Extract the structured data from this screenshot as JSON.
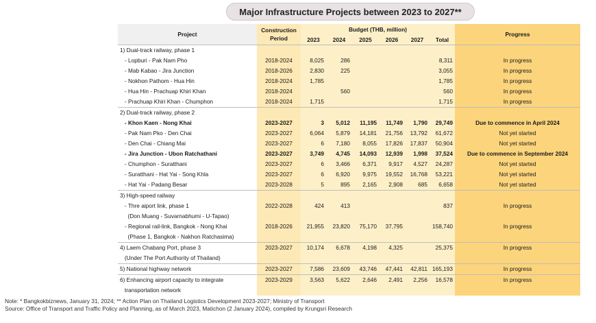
{
  "title": "Major Infrastructure Projects between 2023 to 2027**",
  "headers": {
    "project": "Project",
    "period": "Construction Period",
    "budget": "Budget (THB, million)",
    "years": [
      "2023",
      "2024",
      "2025",
      "2026",
      "2027",
      "Total"
    ],
    "progress": "Progress"
  },
  "rows": [
    {
      "project": "1) Dual-track railway, phase 1",
      "period": "",
      "v": [
        "",
        "",
        "",
        "",
        "",
        ""
      ],
      "progress": "",
      "sep": true
    },
    {
      "project": "   - Lopburi - Pak Nam Pho",
      "period": "2018-2024",
      "v": [
        "8,025",
        "286",
        "",
        "",
        "",
        "8,311"
      ],
      "progress": "In progress"
    },
    {
      "project": "   - Mab Kabao - Jira Junction",
      "period": "2018-2026",
      "v": [
        "2,830",
        "225",
        "",
        "",
        "",
        "3,055"
      ],
      "progress": "In progress"
    },
    {
      "project": "   - Nokhon Pathom - Hua Hin",
      "period": "2018-2024",
      "v": [
        "1,785",
        "",
        "",
        "",
        "",
        "1,785"
      ],
      "progress": "In progress"
    },
    {
      "project": "   - Hua Hin - Prachuap Khiri Khan",
      "period": "2018-2024",
      "v": [
        "",
        "560",
        "",
        "",
        "",
        "560"
      ],
      "progress": "In progress"
    },
    {
      "project": "   - Prachuap Khiri Khan - Chumphon",
      "period": "2018-2024",
      "v": [
        "1,715",
        "",
        "",
        "",
        "",
        "1,715"
      ],
      "progress": "In progress"
    },
    {
      "project": "2) Dual-track railway, phase 2",
      "period": "",
      "v": [
        "",
        "",
        "",
        "",
        "",
        ""
      ],
      "progress": "",
      "sep": true
    },
    {
      "project": "   - Khon Kaen - Nong Khai",
      "period": "2023-2027",
      "v": [
        "3",
        "5,012",
        "11,195",
        "11,749",
        "1,790",
        "29,749"
      ],
      "progress": "Due to commence in April 2024",
      "bold": true
    },
    {
      "project": "   - Pak Nam Pko - Den Chai",
      "period": "2023-2027",
      "v": [
        "6,064",
        "5,879",
        "14,181",
        "21,756",
        "13,792",
        "61,672"
      ],
      "progress": "Not yet started"
    },
    {
      "project": "   - Den Chai - Chiang Mai",
      "period": "2023-2027",
      "v": [
        "6",
        "7,180",
        "8,055",
        "17,826",
        "17,837",
        "50,904"
      ],
      "progress": "Not yet started"
    },
    {
      "project": "   - Jira Junction - Ubon Ratchathani",
      "period": "2023-2027",
      "v": [
        "3,749",
        "4,745",
        "14,093",
        "12,939",
        "1,998",
        "37,524"
      ],
      "progress": "Due to commence in September 2024",
      "bold": true
    },
    {
      "project": "   - Chumphon - Suratthani",
      "period": "2023-2027",
      "v": [
        "6",
        "3,466",
        "6,371",
        "9,917",
        "4,527",
        "24,287"
      ],
      "progress": "Not yet started"
    },
    {
      "project": "   - Suratthani - Hat Yai - Song Khla",
      "period": "2023-2027",
      "v": [
        "6",
        "6,920",
        "9,975",
        "19,552",
        "16,768",
        "53,221"
      ],
      "progress": "Not yet started"
    },
    {
      "project": "   - Hat Yai - Padang Besar",
      "period": "2023-2028",
      "v": [
        "5",
        "895",
        "2,165",
        "2,908",
        "685",
        "6,658"
      ],
      "progress": "Not yet started"
    },
    {
      "project": "3) High-speed railway",
      "period": "",
      "v": [
        "",
        "",
        "",
        "",
        "",
        ""
      ],
      "progress": "",
      "sep": true
    },
    {
      "project": "   - Thre aiport link, phase 1",
      "period": "2022-2028",
      "v": [
        "424",
        "413",
        "",
        "",
        "",
        "837"
      ],
      "progress": "In progress"
    },
    {
      "project": "     (Don Muang - Suvarnabhumi - U-Tapao)",
      "period": "",
      "v": [
        "",
        "",
        "",
        "",
        "",
        ""
      ],
      "progress": ""
    },
    {
      "project": "   - Regional rail-link, Bangkok - Nong Khai",
      "period": "2018-2026",
      "v": [
        "21,955",
        "23,820",
        "75,170",
        "37,795",
        "",
        "158,740"
      ],
      "progress": "In progress"
    },
    {
      "project": "     (Phase 1, Bangkok - Nakhon Ratchasima)",
      "period": "",
      "v": [
        "",
        "",
        "",
        "",
        "",
        ""
      ],
      "progress": ""
    },
    {
      "project": "4) Laem Chabang Port, phase 3",
      "period": "2023-2027",
      "v": [
        "10,174",
        "6,678",
        "4,198",
        "4,325",
        "",
        "25,375"
      ],
      "progress": "In progress",
      "sep": true
    },
    {
      "project": "   (Under The Port Authority of Thailand)",
      "period": "",
      "v": [
        "",
        "",
        "",
        "",
        "",
        ""
      ],
      "progress": ""
    },
    {
      "project": "5) National highway network",
      "period": "2023-2027",
      "v": [
        "7,586",
        "23,609",
        "43,746",
        "47,441",
        "42,811",
        "165,193"
      ],
      "progress": "In progress",
      "sep": true
    },
    {
      "project": "6) Enhancing airport capacity to integrate",
      "period": "2023-2029",
      "v": [
        "3,563",
        "5,622",
        "2,646",
        "2,491",
        "2,256",
        "16,578"
      ],
      "progress": "In progress",
      "sep": true
    },
    {
      "project": "   transportation network",
      "period": "",
      "v": [
        "",
        "",
        "",
        "",
        "",
        ""
      ],
      "progress": ""
    }
  ],
  "notes": {
    "line1": "Note: * Bangkokbiznews, January 31, 2024;  ** Action Plan on Thailand Logistics Development 2023-2027; Ministry of Transport",
    "line2": "Source: Office of Transport and Traffic Policy and Planning, as of March 2023, Matichon (2 January 2024), compiled by Krungsri Research"
  }
}
